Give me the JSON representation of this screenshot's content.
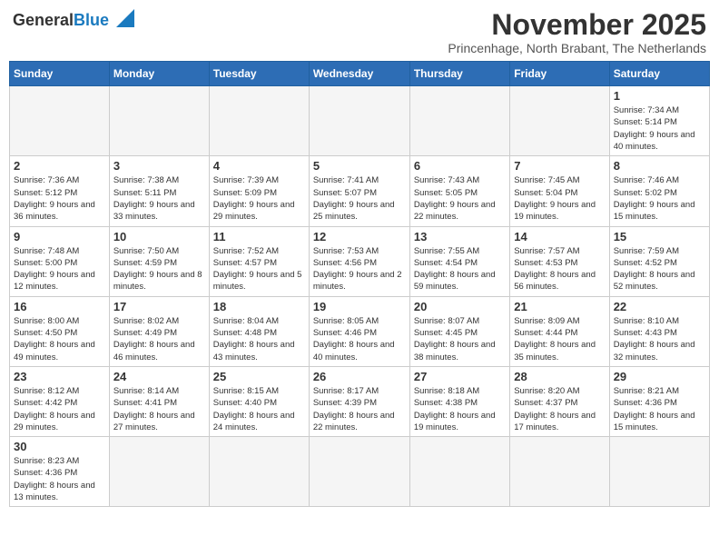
{
  "header": {
    "logo_general": "General",
    "logo_blue": "Blue",
    "month_title": "November 2025",
    "subtitle": "Princenhage, North Brabant, The Netherlands"
  },
  "weekdays": [
    "Sunday",
    "Monday",
    "Tuesday",
    "Wednesday",
    "Thursday",
    "Friday",
    "Saturday"
  ],
  "weeks": [
    [
      {
        "day": "",
        "info": ""
      },
      {
        "day": "",
        "info": ""
      },
      {
        "day": "",
        "info": ""
      },
      {
        "day": "",
        "info": ""
      },
      {
        "day": "",
        "info": ""
      },
      {
        "day": "",
        "info": ""
      },
      {
        "day": "1",
        "info": "Sunrise: 7:34 AM\nSunset: 5:14 PM\nDaylight: 9 hours and 40 minutes."
      }
    ],
    [
      {
        "day": "2",
        "info": "Sunrise: 7:36 AM\nSunset: 5:12 PM\nDaylight: 9 hours and 36 minutes."
      },
      {
        "day": "3",
        "info": "Sunrise: 7:38 AM\nSunset: 5:11 PM\nDaylight: 9 hours and 33 minutes."
      },
      {
        "day": "4",
        "info": "Sunrise: 7:39 AM\nSunset: 5:09 PM\nDaylight: 9 hours and 29 minutes."
      },
      {
        "day": "5",
        "info": "Sunrise: 7:41 AM\nSunset: 5:07 PM\nDaylight: 9 hours and 25 minutes."
      },
      {
        "day": "6",
        "info": "Sunrise: 7:43 AM\nSunset: 5:05 PM\nDaylight: 9 hours and 22 minutes."
      },
      {
        "day": "7",
        "info": "Sunrise: 7:45 AM\nSunset: 5:04 PM\nDaylight: 9 hours and 19 minutes."
      },
      {
        "day": "8",
        "info": "Sunrise: 7:46 AM\nSunset: 5:02 PM\nDaylight: 9 hours and 15 minutes."
      }
    ],
    [
      {
        "day": "9",
        "info": "Sunrise: 7:48 AM\nSunset: 5:00 PM\nDaylight: 9 hours and 12 minutes."
      },
      {
        "day": "10",
        "info": "Sunrise: 7:50 AM\nSunset: 4:59 PM\nDaylight: 9 hours and 8 minutes."
      },
      {
        "day": "11",
        "info": "Sunrise: 7:52 AM\nSunset: 4:57 PM\nDaylight: 9 hours and 5 minutes."
      },
      {
        "day": "12",
        "info": "Sunrise: 7:53 AM\nSunset: 4:56 PM\nDaylight: 9 hours and 2 minutes."
      },
      {
        "day": "13",
        "info": "Sunrise: 7:55 AM\nSunset: 4:54 PM\nDaylight: 8 hours and 59 minutes."
      },
      {
        "day": "14",
        "info": "Sunrise: 7:57 AM\nSunset: 4:53 PM\nDaylight: 8 hours and 56 minutes."
      },
      {
        "day": "15",
        "info": "Sunrise: 7:59 AM\nSunset: 4:52 PM\nDaylight: 8 hours and 52 minutes."
      }
    ],
    [
      {
        "day": "16",
        "info": "Sunrise: 8:00 AM\nSunset: 4:50 PM\nDaylight: 8 hours and 49 minutes."
      },
      {
        "day": "17",
        "info": "Sunrise: 8:02 AM\nSunset: 4:49 PM\nDaylight: 8 hours and 46 minutes."
      },
      {
        "day": "18",
        "info": "Sunrise: 8:04 AM\nSunset: 4:48 PM\nDaylight: 8 hours and 43 minutes."
      },
      {
        "day": "19",
        "info": "Sunrise: 8:05 AM\nSunset: 4:46 PM\nDaylight: 8 hours and 40 minutes."
      },
      {
        "day": "20",
        "info": "Sunrise: 8:07 AM\nSunset: 4:45 PM\nDaylight: 8 hours and 38 minutes."
      },
      {
        "day": "21",
        "info": "Sunrise: 8:09 AM\nSunset: 4:44 PM\nDaylight: 8 hours and 35 minutes."
      },
      {
        "day": "22",
        "info": "Sunrise: 8:10 AM\nSunset: 4:43 PM\nDaylight: 8 hours and 32 minutes."
      }
    ],
    [
      {
        "day": "23",
        "info": "Sunrise: 8:12 AM\nSunset: 4:42 PM\nDaylight: 8 hours and 29 minutes."
      },
      {
        "day": "24",
        "info": "Sunrise: 8:14 AM\nSunset: 4:41 PM\nDaylight: 8 hours and 27 minutes."
      },
      {
        "day": "25",
        "info": "Sunrise: 8:15 AM\nSunset: 4:40 PM\nDaylight: 8 hours and 24 minutes."
      },
      {
        "day": "26",
        "info": "Sunrise: 8:17 AM\nSunset: 4:39 PM\nDaylight: 8 hours and 22 minutes."
      },
      {
        "day": "27",
        "info": "Sunrise: 8:18 AM\nSunset: 4:38 PM\nDaylight: 8 hours and 19 minutes."
      },
      {
        "day": "28",
        "info": "Sunrise: 8:20 AM\nSunset: 4:37 PM\nDaylight: 8 hours and 17 minutes."
      },
      {
        "day": "29",
        "info": "Sunrise: 8:21 AM\nSunset: 4:36 PM\nDaylight: 8 hours and 15 minutes."
      }
    ],
    [
      {
        "day": "30",
        "info": "Sunrise: 8:23 AM\nSunset: 4:36 PM\nDaylight: 8 hours and 13 minutes."
      },
      {
        "day": "",
        "info": ""
      },
      {
        "day": "",
        "info": ""
      },
      {
        "day": "",
        "info": ""
      },
      {
        "day": "",
        "info": ""
      },
      {
        "day": "",
        "info": ""
      },
      {
        "day": "",
        "info": ""
      }
    ]
  ]
}
